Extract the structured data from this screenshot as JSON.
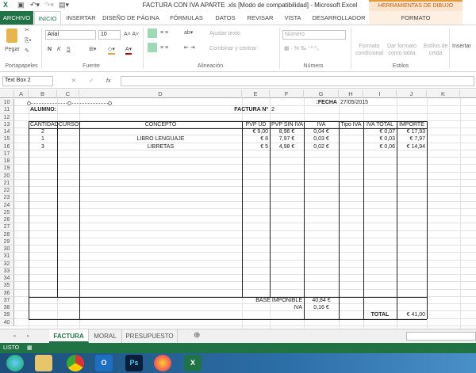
{
  "window": {
    "title": "FACTURA CON IVA APARTE .xls  [Modo de compatibilidad] - Microsoft Excel",
    "contextual": "HERRAMIENTAS DE DIBUJO"
  },
  "tabs": [
    "ARCHIVO",
    "INICIO",
    "INSERTAR",
    "DISEÑO DE PÁGINA",
    "FÓRMULAS",
    "DATOS",
    "REVISAR",
    "VISTA",
    "DESARROLLADOR",
    "FORMATO"
  ],
  "ribbon": {
    "paste": "Pegar",
    "font_name": "Arial",
    "font_size": "10",
    "wrap": "Ajustar texto",
    "merge": "Combinar y centrar",
    "number_format": "Número",
    "cond_format": [
      "Formato",
      "condicional"
    ],
    "table_format": [
      "Dar formato",
      "como tabla"
    ],
    "cell_styles": [
      "Estilos de",
      "celda"
    ],
    "insert": "Insertar",
    "bold": "N",
    "italic": "K",
    "underline": "S",
    "groups": [
      "Portapapeles",
      "Fuente",
      "Alineación",
      "Número",
      "Estilos"
    ]
  },
  "formula_bar": {
    "name_box": "Text Box 2",
    "value": "",
    "fx": "fx"
  },
  "columns": [
    "A",
    "B",
    "C",
    "D",
    "E",
    "F",
    "G",
    "H",
    "I",
    "J",
    "K"
  ],
  "rows_range": [
    10,
    40
  ],
  "cells": [
    {
      "r": 10,
      "c": "G",
      "v": "FECHA:",
      "b": true,
      "a": "right"
    },
    {
      "r": 10,
      "c": "H",
      "v": "27/05/2015",
      "a": "left"
    },
    {
      "r": 11,
      "c": "B",
      "v": "ALUMNO:",
      "b": true,
      "a": "left"
    },
    {
      "r": 11,
      "c": "E",
      "v": "FACTURA Nº",
      "b": true,
      "a": "right"
    },
    {
      "r": 11,
      "c": "F",
      "v": "2",
      "a": "left"
    },
    {
      "r": 13,
      "c": "B",
      "v": "CANTIDAD",
      "a": "center"
    },
    {
      "r": 13,
      "c": "C",
      "v": "CURSO",
      "a": "center"
    },
    {
      "r": 13,
      "c": "D",
      "v": "CONCEPTO",
      "a": "center"
    },
    {
      "r": 13,
      "c": "E",
      "v": "PVP UD",
      "a": "center"
    },
    {
      "r": 13,
      "c": "F",
      "v": "PVP SIN IVA",
      "a": "center"
    },
    {
      "r": 13,
      "c": "G",
      "v": "IVA",
      "a": "center"
    },
    {
      "r": 13,
      "c": "H",
      "v": "Tipo IVA",
      "a": "center"
    },
    {
      "r": 13,
      "c": "I",
      "v": "IVA TOTAL",
      "a": "center"
    },
    {
      "r": 13,
      "c": "J",
      "v": "IMPORTE",
      "a": "center"
    },
    {
      "r": 14,
      "c": "B",
      "v": "2",
      "a": "center"
    },
    {
      "r": 14,
      "c": "E",
      "v": "9,00 €",
      "a": "right"
    },
    {
      "r": 14,
      "c": "F",
      "v": "8,96 €",
      "a": "center"
    },
    {
      "r": 14,
      "c": "G",
      "v": "0,04 €",
      "a": "center"
    },
    {
      "r": 14,
      "c": "I",
      "v": "0,07 €",
      "a": "right"
    },
    {
      "r": 14,
      "c": "J",
      "v": "17,93 €",
      "a": "right"
    },
    {
      "r": 15,
      "c": "B",
      "v": "1",
      "a": "center"
    },
    {
      "r": 15,
      "c": "D",
      "v": "LIBRO LENGUAJE",
      "a": "center"
    },
    {
      "r": 15,
      "c": "E",
      "v": "8 €",
      "a": "right"
    },
    {
      "r": 15,
      "c": "F",
      "v": "7,97 €",
      "a": "center"
    },
    {
      "r": 15,
      "c": "G",
      "v": "0,03 €",
      "a": "center"
    },
    {
      "r": 15,
      "c": "I",
      "v": "0,03 €",
      "a": "right"
    },
    {
      "r": 15,
      "c": "J",
      "v": "7,97 €",
      "a": "right"
    },
    {
      "r": 16,
      "c": "B",
      "v": "3",
      "a": "center"
    },
    {
      "r": 16,
      "c": "D",
      "v": "LIBRETAS",
      "a": "center"
    },
    {
      "r": 16,
      "c": "E",
      "v": "5 €",
      "a": "right"
    },
    {
      "r": 16,
      "c": "F",
      "v": "4,98 €",
      "a": "center"
    },
    {
      "r": 16,
      "c": "G",
      "v": "0,02 €",
      "a": "center"
    },
    {
      "r": 16,
      "c": "I",
      "v": "0,06 €",
      "a": "right"
    },
    {
      "r": 16,
      "c": "J",
      "v": "14,94 €",
      "a": "right"
    },
    {
      "r": 37,
      "c": "F",
      "v": "BASE IMPONIBLE",
      "a": "right"
    },
    {
      "r": 37,
      "c": "G",
      "v": "40,84 €",
      "a": "center"
    },
    {
      "r": 38,
      "c": "F",
      "v": "IVA",
      "a": "right"
    },
    {
      "r": 38,
      "c": "G",
      "v": "0,16 €",
      "a": "center"
    },
    {
      "r": 39,
      "c": "I",
      "v": "TOTAL",
      "b": true,
      "a": "center"
    },
    {
      "r": 39,
      "c": "J",
      "v": "41,00 €",
      "a": "right"
    }
  ],
  "sheets": [
    "FACTURA",
    "MORAL",
    "PRESUPUESTO"
  ],
  "status": {
    "text": "LISTO"
  },
  "taskbar": [
    "windows-start",
    "file-explorer",
    "chrome",
    "outlook",
    "photoshop",
    "firefox",
    "excel"
  ],
  "colors": {
    "excel_green": "#217346",
    "contextual": "#c55a11"
  }
}
